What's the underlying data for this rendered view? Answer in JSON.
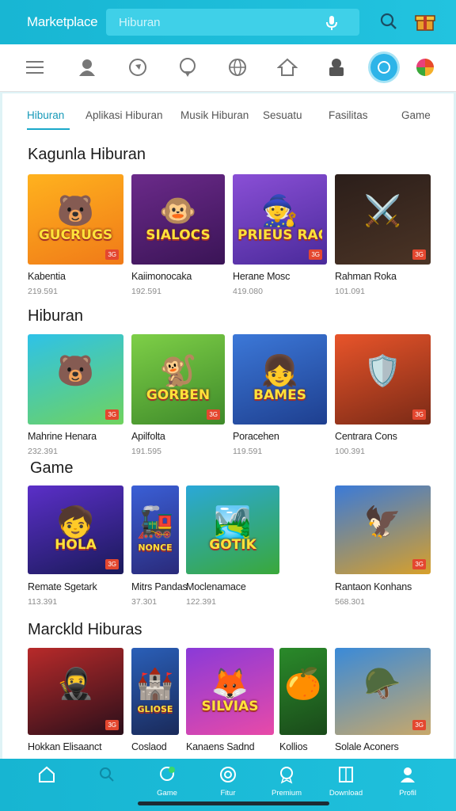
{
  "app": {
    "title": "Marketplace",
    "search_placeholder": "Hiburan"
  },
  "tabs": [
    {
      "label": "Hiburan",
      "active": true
    },
    {
      "label": "Aplikasi Hiburan",
      "active": false
    },
    {
      "label": "Musik Hiburan",
      "active": false
    },
    {
      "label": "Sesuatu",
      "active": false
    },
    {
      "label": "Fasilitas",
      "active": false
    },
    {
      "label": "Game",
      "active": false
    }
  ],
  "sections": [
    {
      "title": "Kagunla Hiburan",
      "items": [
        {
          "name": "Kabentia",
          "meta": "219.591",
          "art": "GUCRUGS",
          "badge": "3G",
          "colors": [
            "#ffb21e",
            "#f07a18"
          ],
          "glyph": "🐻"
        },
        {
          "name": "Kaiimonocaka",
          "meta": "192.591",
          "art": "SIALOCS",
          "badge": "",
          "colors": [
            "#6b2a8a",
            "#3a1456"
          ],
          "glyph": "🐵"
        },
        {
          "name": "Herane Mosc",
          "meta": "419.080",
          "art": "PRIEUS RAC",
          "badge": "3G",
          "colors": [
            "#8a4fd6",
            "#4a2a9a"
          ],
          "glyph": "🧙"
        },
        {
          "name": "Rahman Roka",
          "meta": "101.091",
          "art": "",
          "badge": "3G",
          "colors": [
            "#2b1e1a",
            "#4b3425"
          ],
          "glyph": "⚔️"
        }
      ]
    },
    {
      "title": "Hiburan",
      "items": [
        {
          "name": "Mahrine Henara",
          "meta": "232.391",
          "art": "",
          "badge": "3G",
          "colors": [
            "#2ec2e8",
            "#6fd35e"
          ],
          "glyph": "🐻"
        },
        {
          "name": "Apilfolta",
          "meta": "191.595",
          "art": "GORBEN",
          "badge": "3G",
          "colors": [
            "#7ecf47",
            "#3e8a2a"
          ],
          "glyph": "🐒"
        },
        {
          "name": "Poracehen",
          "meta": "119.591",
          "art": "BAMES",
          "badge": "",
          "colors": [
            "#3c78d8",
            "#1e3f8f"
          ],
          "glyph": "👧"
        },
        {
          "name": "Centrara Cons",
          "meta": "100.391",
          "art": "",
          "badge": "3G",
          "colors": [
            "#e8542a",
            "#7a2a16"
          ],
          "glyph": "🛡️"
        }
      ]
    },
    {
      "title": "Game",
      "items": [
        {
          "name": "Remate Sgetark",
          "meta": "113.391",
          "art": "HOLA",
          "badge": "3G",
          "colors": [
            "#5b2fc8",
            "#1a1a5a"
          ],
          "glyph": "🧒"
        },
        {
          "name": "Mitrs Pandas",
          "meta": "37.301",
          "art": "NONCE",
          "badge": "",
          "colors": [
            "#3a5fd6",
            "#2a2a7a"
          ],
          "glyph": "🚂"
        },
        {
          "name": "Moclenamace",
          "meta": "122.391",
          "art": "GOTIK",
          "badge": "",
          "colors": [
            "#2aa8d8",
            "#3aa83a"
          ],
          "glyph": "🏞️"
        },
        {
          "name": "Rantaon Konhans",
          "meta": "568.301",
          "art": "",
          "badge": "3G",
          "colors": [
            "#3a7ad8",
            "#d8a02a"
          ],
          "glyph": "🦅"
        }
      ]
    },
    {
      "title": "Marckld Hiburas",
      "items": [
        {
          "name": "Hokkan Elisaanct",
          "meta": "",
          "art": "",
          "badge": "3G",
          "colors": [
            "#b82a2a",
            "#2a0f1a"
          ],
          "glyph": "🥷"
        },
        {
          "name": "Coslaod",
          "meta": "",
          "art": "GLIOSE",
          "badge": "",
          "colors": [
            "#2a5fb8",
            "#1a2a5a"
          ],
          "glyph": "🏰"
        },
        {
          "name": "Kanaens Sadnd",
          "meta": "",
          "art": "SILVIAS",
          "badge": "",
          "colors": [
            "#8a3ad8",
            "#e84aa8"
          ],
          "glyph": "🦊"
        },
        {
          "name": "Kollios",
          "meta": "",
          "art": "",
          "badge": "",
          "colors": [
            "#2a8a2a",
            "#1a4a1a"
          ],
          "glyph": "🍊"
        },
        {
          "name": "Solale Aconers",
          "meta": "",
          "art": "",
          "badge": "3G",
          "colors": [
            "#3a8ad8",
            "#c8a86a"
          ],
          "glyph": "🪖"
        }
      ]
    }
  ],
  "bottom_nav": [
    {
      "label": "",
      "icon": "home-icon"
    },
    {
      "label": "",
      "icon": "search-icon"
    },
    {
      "label": "Game",
      "icon": "chat-icon"
    },
    {
      "label": "Fitur",
      "icon": "refresh-icon"
    },
    {
      "label": "Premium",
      "icon": "badge-icon"
    },
    {
      "label": "Download",
      "icon": "book-icon"
    },
    {
      "label": "Profil",
      "icon": "profile-icon"
    }
  ],
  "colors": {
    "accent": "#1ab4d2",
    "badge": "#e4472f"
  }
}
